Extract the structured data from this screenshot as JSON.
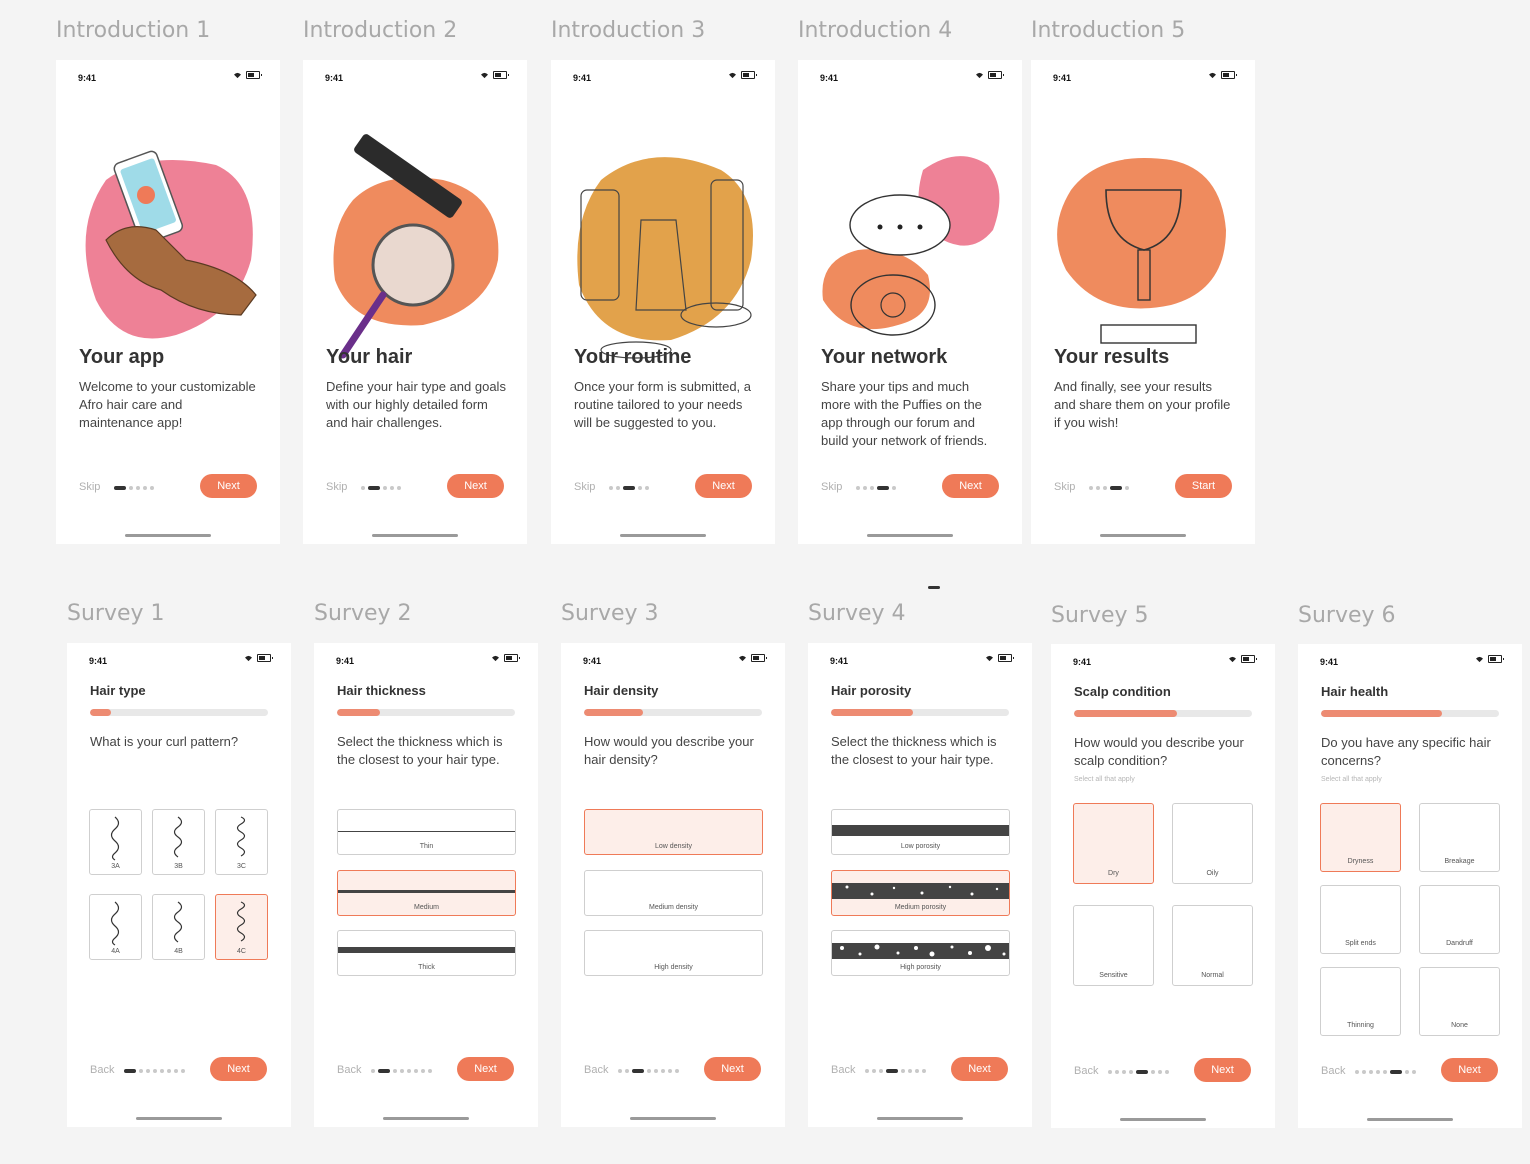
{
  "status_time": "9:41",
  "colors": {
    "accent": "#ef7a58",
    "accent_light": "#fdeee9",
    "pink": "#ee8196",
    "orange": "#ef8b5e",
    "ochre": "#e2a24b"
  },
  "intro": [
    {
      "label": "Introduction 1",
      "title": "Your app",
      "body": "Welcome to your customizable Afro hair care and maintenance app!",
      "skip": "Skip",
      "button": "Next",
      "step": 0,
      "icon": "hand-phone-illustration"
    },
    {
      "label": "Introduction 2",
      "title": "Your hair",
      "body": "Define your hair type and goals with our highly detailed form and hair challenges.",
      "skip": "Skip",
      "button": "Next",
      "step": 1,
      "icon": "comb-magnifier-illustration"
    },
    {
      "label": "Introduction 3",
      "title": "Your routine",
      "body": "Once your form is submitted, a routine tailored to your needs will be suggested to you.",
      "skip": "Skip",
      "button": "Next",
      "step": 2,
      "icon": "hair-products-illustration"
    },
    {
      "label": "Introduction 4",
      "title": "Your network",
      "body": "Share your tips and much more with the Puffies on the app through our forum and build your network of friends.",
      "skip": "Skip",
      "button": "Next",
      "step": 3,
      "icon": "chat-bubbles-illustration"
    },
    {
      "label": "Introduction 5",
      "title": "Your results",
      "body": "And finally, see your results and share them on your profile if you wish!",
      "skip": "Skip",
      "button": "Start",
      "step": 3,
      "icon": "trophy-illustration"
    }
  ],
  "survey": [
    {
      "label": "Survey 1",
      "title": "Hair type",
      "question": "What is your curl pattern?",
      "progress": 0.12,
      "back": "Back",
      "button": "Next",
      "step": 0,
      "options": [
        {
          "label": "3A",
          "selected": false
        },
        {
          "label": "3B",
          "selected": false
        },
        {
          "label": "3C",
          "selected": false
        },
        {
          "label": "4A",
          "selected": false
        },
        {
          "label": "4B",
          "selected": false
        },
        {
          "label": "4C",
          "selected": true
        }
      ]
    },
    {
      "label": "Survey 2",
      "title": "Hair thickness",
      "question": "Select the thickness which is the closest to your hair type.",
      "progress": 0.24,
      "back": "Back",
      "button": "Next",
      "step": 1,
      "options": [
        {
          "label": "Thin",
          "selected": false
        },
        {
          "label": "Medium",
          "selected": true
        },
        {
          "label": "Thick",
          "selected": false
        }
      ]
    },
    {
      "label": "Survey 3",
      "title": "Hair density",
      "question": "How would you describe your hair density?",
      "progress": 0.33,
      "back": "Back",
      "button": "Next",
      "step": 2,
      "options": [
        {
          "label": "Low density",
          "selected": true
        },
        {
          "label": "Medium density",
          "selected": false
        },
        {
          "label": "High density",
          "selected": false
        }
      ]
    },
    {
      "label": "Survey 4",
      "title": "Hair porosity",
      "question": "Select the thickness which is the closest to your hair type.",
      "progress": 0.46,
      "back": "Back",
      "button": "Next",
      "step": 3,
      "options": [
        {
          "label": "Low porosity",
          "selected": false
        },
        {
          "label": "Medium porosity",
          "selected": true
        },
        {
          "label": "High porosity",
          "selected": false
        }
      ]
    },
    {
      "label": "Survey 5",
      "title": "Scalp condition",
      "question": "How would you describe your scalp condition?",
      "hint": "Select all that apply",
      "progress": 0.58,
      "back": "Back",
      "button": "Next",
      "step": 4,
      "options": [
        {
          "label": "Dry",
          "selected": true
        },
        {
          "label": "Oily",
          "selected": false
        },
        {
          "label": "Sensitive",
          "selected": false
        },
        {
          "label": "Normal",
          "selected": false
        }
      ]
    },
    {
      "label": "Survey 6",
      "title": "Hair health",
      "question": "Do you have any specific hair concerns?",
      "hint": "Select all that apply",
      "progress": 0.68,
      "back": "Back",
      "button": "Next",
      "step": 5,
      "options": [
        {
          "label": "Dryness",
          "selected": true
        },
        {
          "label": "Breakage",
          "selected": false
        },
        {
          "label": "Split ends",
          "selected": false
        },
        {
          "label": "Dandruff",
          "selected": false
        },
        {
          "label": "Thinning",
          "selected": false
        },
        {
          "label": "None",
          "selected": false
        }
      ]
    }
  ]
}
